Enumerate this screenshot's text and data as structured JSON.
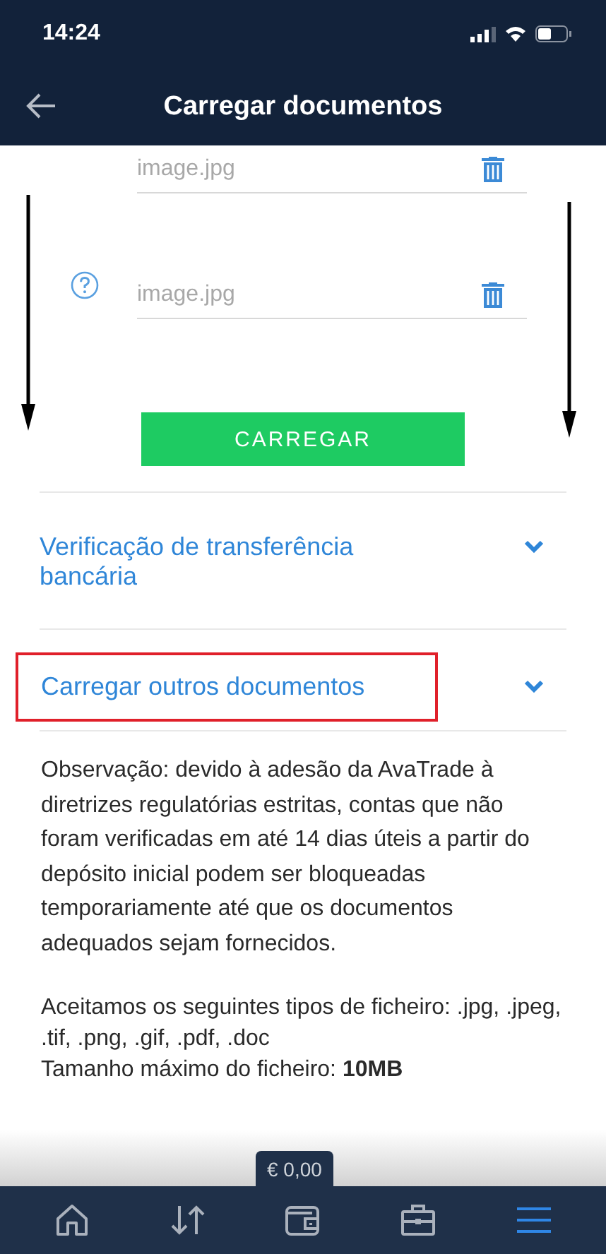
{
  "status_bar": {
    "time": "14:24"
  },
  "header": {
    "title": "Carregar documentos"
  },
  "files": [
    {
      "value": "image.jpg",
      "help": false
    },
    {
      "value": "image.jpg",
      "help": true
    }
  ],
  "upload_button": "CARREGAR",
  "sections": [
    {
      "title": "Verificação de transferência bancária",
      "expanded": false,
      "highlighted": false
    },
    {
      "title": "Carregar outros documentos",
      "expanded": false,
      "highlighted": true
    }
  ],
  "note": "Observação: devido à adesão da AvaTrade à diretrizes regulatórias estritas, contas que não foram verificadas em até 14 dias úteis a partir do depósito inicial podem ser bloqueadas temporariamente até que os documentos adequados sejam fornecidos.",
  "file_types": "Aceitamos os seguintes tipos de ficheiro: .jpg, .jpeg, .tif, .png, .gif, .pdf, .doc",
  "max_size": "Tamanho máximo do ficheiro: **10MB**",
  "balance": "€ 0,00",
  "nav": [
    {
      "kind": "home",
      "selected": false
    },
    {
      "kind": "transfer",
      "selected": false
    },
    {
      "kind": "wallet",
      "selected": false
    },
    {
      "kind": "portfolio",
      "selected": false
    },
    {
      "kind": "menu",
      "selected": true
    }
  ]
}
